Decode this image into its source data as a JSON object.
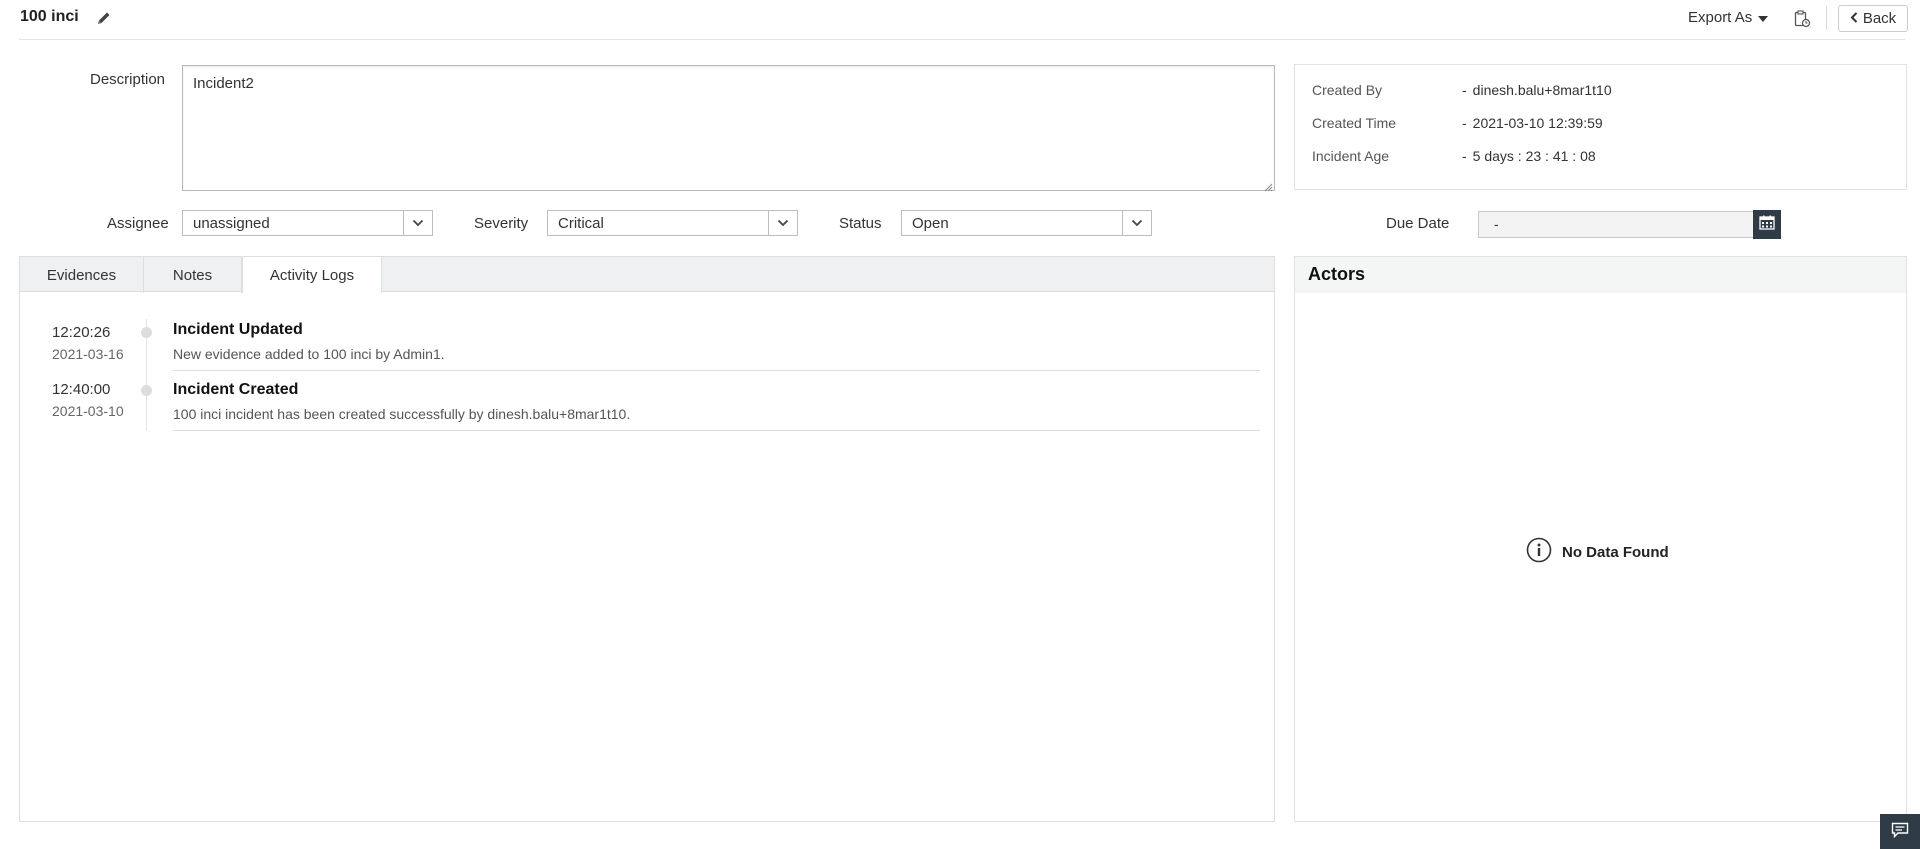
{
  "header": {
    "title": "100 inci",
    "export_label": "Export As",
    "back_label": "Back"
  },
  "description": {
    "label": "Description",
    "value": "Incident2"
  },
  "info": {
    "rows": [
      {
        "key": "Created By",
        "sep": "-",
        "value": "dinesh.balu+8mar1t10"
      },
      {
        "key": "Created Time",
        "sep": "-",
        "value": "2021-03-10 12:39:59"
      },
      {
        "key": "Incident Age",
        "sep": "-",
        "value": "5 days : 23 : 41 : 08"
      }
    ]
  },
  "fields": {
    "assignee": {
      "label": "Assignee",
      "value": "unassigned"
    },
    "severity": {
      "label": "Severity",
      "value": "Critical"
    },
    "status": {
      "label": "Status",
      "value": "Open"
    },
    "due_date": {
      "label": "Due Date",
      "value": "-"
    }
  },
  "tabs": [
    {
      "label": "Evidences"
    },
    {
      "label": "Notes"
    },
    {
      "label": "Activity Logs"
    }
  ],
  "activity_logs": [
    {
      "time": "12:20:26",
      "date": "2021-03-16",
      "title": "Incident Updated",
      "message": "New evidence added to 100 inci by Admin1."
    },
    {
      "time": "12:40:00",
      "date": "2021-03-10",
      "title": "Incident Created",
      "message": "100 inci incident has been created successfully by dinesh.balu+8mar1t10."
    }
  ],
  "actors": {
    "title": "Actors",
    "empty_text": "No Data Found"
  },
  "colors": {
    "dark_button": "#2f3b46",
    "tab_bar": "#eef0f1",
    "border": "#dedede"
  },
  "icons": [
    "pencil-icon",
    "chevron-down-icon",
    "clipboard-icon",
    "chevron-left-icon",
    "calendar-icon",
    "info-circle-icon",
    "chat-icon"
  ]
}
